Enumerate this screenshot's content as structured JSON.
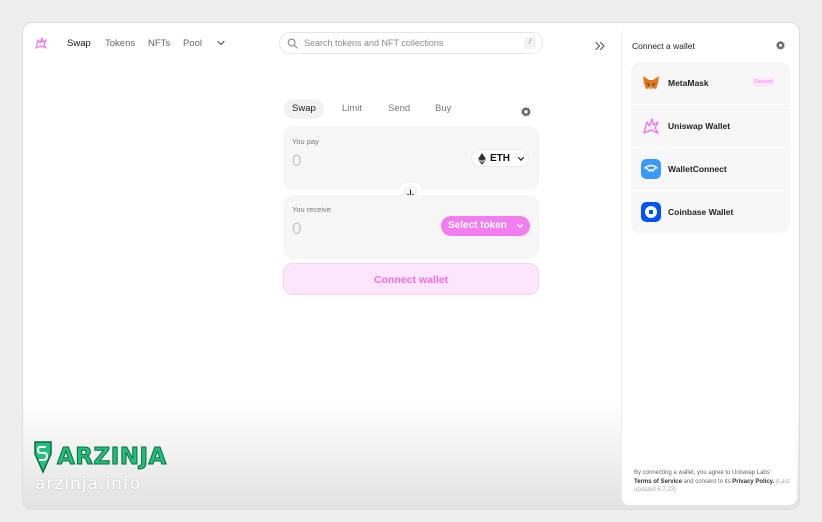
{
  "nav": {
    "links": [
      "Swap",
      "Tokens",
      "NFTs",
      "Pool"
    ],
    "search_placeholder": "Search tokens and NFT collections",
    "search_shortcut": "/"
  },
  "swap": {
    "tabs": [
      "Swap",
      "Limit",
      "Send",
      "Buy"
    ],
    "pay_label": "You pay",
    "pay_amount": "0",
    "pay_token": "ETH",
    "receive_label": "You receive",
    "receive_amount": "0",
    "select_token_label": "Select token",
    "connect_label": "Connect wallet"
  },
  "drawer": {
    "title": "Connect a wallet",
    "wallets": [
      {
        "name": "MetaMask",
        "badge": "Recent",
        "icon": "metamask-fox-icon"
      },
      {
        "name": "Uniswap Wallet",
        "icon": "uniswap-unicorn-icon"
      },
      {
        "name": "WalletConnect",
        "icon": "walletconnect-icon"
      },
      {
        "name": "Coinbase Wallet",
        "icon": "coinbase-icon"
      }
    ],
    "legal": {
      "prefix": "By connecting a wallet, you agree to Uniswap Labs'",
      "terms": "Terms of Service",
      "middle": "and consent to its",
      "privacy": "Privacy Policy.",
      "updated": "(Last updated 6.7.23)"
    }
  },
  "watermark": {
    "brand": "ARZINJA",
    "url": "arzinja.info"
  },
  "colors": {
    "accent_pink": "#f27dee",
    "connect_bg": "#fde6fb",
    "watermark_green": "#1fc07a"
  }
}
